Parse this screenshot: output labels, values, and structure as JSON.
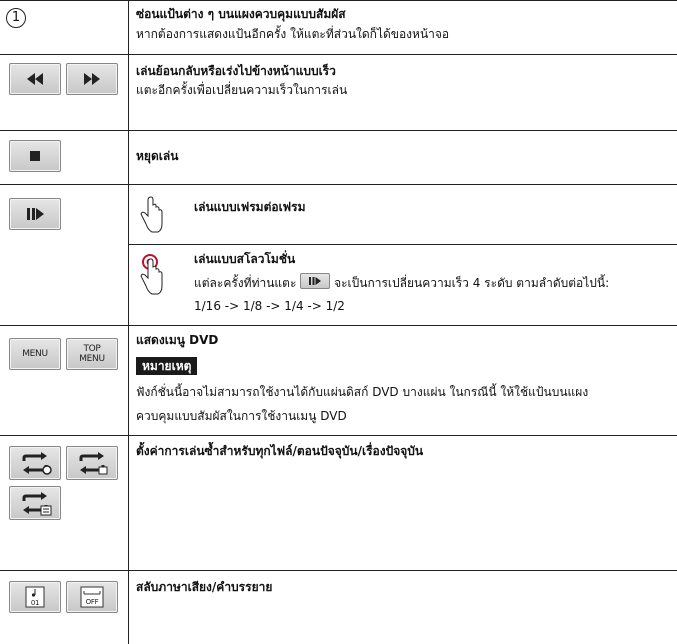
{
  "rows": [
    {
      "title": "ซ่อนแป้นต่าง ๆ บนแผงควบคุมแบบสัมผัส",
      "desc": "หากต้องการแสดงแป้นอีกครั้ง ให้แตะที่ส่วนใดก็ได้ของหน้าจอ",
      "marker": "1"
    },
    {
      "title": "เล่นย้อนกลับหรือเร่งไปข้างหน้าแบบเร็ว",
      "desc": "แตะอีกครั้งเพื่อเปลี่ยนความเร็วในการเล่น"
    },
    {
      "title": "หยุดเล่น"
    },
    {
      "sub1_title": "เล่นแบบเฟรมต่อเฟรม",
      "sub2_title": "เล่นแบบสโลวโมชั่น",
      "sub2_desc_pre": "แต่ละครั้งที่ท่านแตะ",
      "sub2_desc_post": "จะเป็นการเปลี่ยนความเร็ว 4 ระดับ ตามลำดับต่อไปนี้:",
      "sub2_desc_line2": "1/16 -> 1/8 -> 1/4 -> 1/2"
    },
    {
      "title": "แสดงเมนู DVD",
      "note_label": "หมายเหตุ",
      "note_line1": "ฟังก์ชั่นนี้อาจไม่สามารถใช้งานได้กับแผ่นดิสก์ DVD บางแผ่น ในกรณีนี้ ให้ใช้แป้นบนแผง",
      "note_line2": "ควบคุมแบบสัมผัสในการใช้งานเมนู DVD",
      "btn_menu": "MENU",
      "btn_top_1": "TOP",
      "btn_top_2": "MENU"
    },
    {
      "title": "ตั้งค่าการเล่นซ้ำสำหรับทุกไฟล์/ตอนปัจจุบัน/เรื่องปัจจุบัน"
    },
    {
      "title": "สลับภาษาเสียง/คำบรรยาย",
      "btn_audio": "01",
      "btn_sub": "OFF"
    }
  ],
  "icons": {
    "rewind": "rewind-icon",
    "forward": "fast-forward-icon",
    "stop": "stop-icon",
    "frame": "frame-advance-icon",
    "touch": "hand-touch-icon",
    "touch_hold": "hand-touch-hold-icon",
    "repeat_all": "repeat-all-icon",
    "repeat_chapter": "repeat-chapter-icon",
    "repeat_title": "repeat-title-icon",
    "audio": "audio-language-icon",
    "subtitle": "subtitle-icon"
  },
  "colors": {
    "note_badge_bg": "#1a1a1a",
    "touch_hold_accent": "#c0102a"
  }
}
